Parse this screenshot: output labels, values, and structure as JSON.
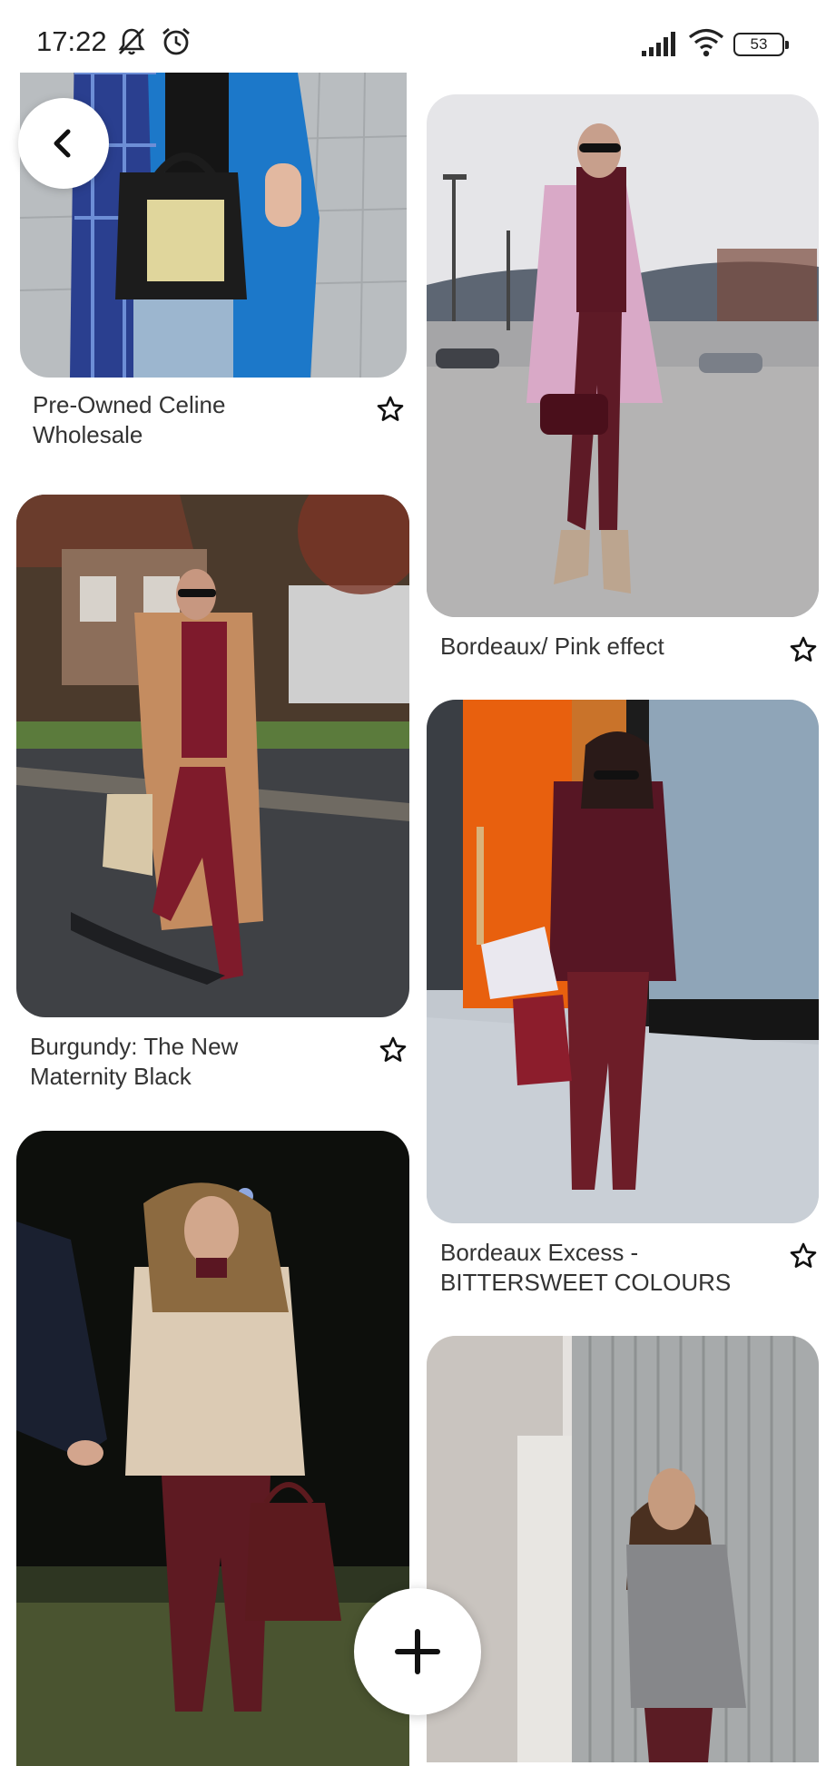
{
  "status_bar": {
    "time": "17:22",
    "icons": [
      "muted-bell-icon",
      "alarm-icon",
      "signal-icon",
      "wifi-icon"
    ],
    "battery": "53"
  },
  "pins": [
    {
      "title": "Pre-Owned Celine Wholesale",
      "image": "blue-coat-celine-bag-photo"
    },
    {
      "title": "Bordeaux/ Pink effect",
      "image": "pink-coat-burgundy-outfit-photo"
    },
    {
      "title": "Burgundy: The New Maternity Black",
      "image": "camel-coat-burgundy-outfit-photo"
    },
    {
      "title": "Bordeaux Excess - BITTERSWEET COLOURS",
      "image": "burgundy-sweater-tory-burch-photo"
    },
    {
      "title": "",
      "image": "beige-coat-night-photo"
    },
    {
      "title": "",
      "image": "grey-sweater-wall-photo"
    }
  ],
  "controls": {
    "back": "chevron-left-icon",
    "add": "plus-icon",
    "save": "star-outline-icon"
  }
}
